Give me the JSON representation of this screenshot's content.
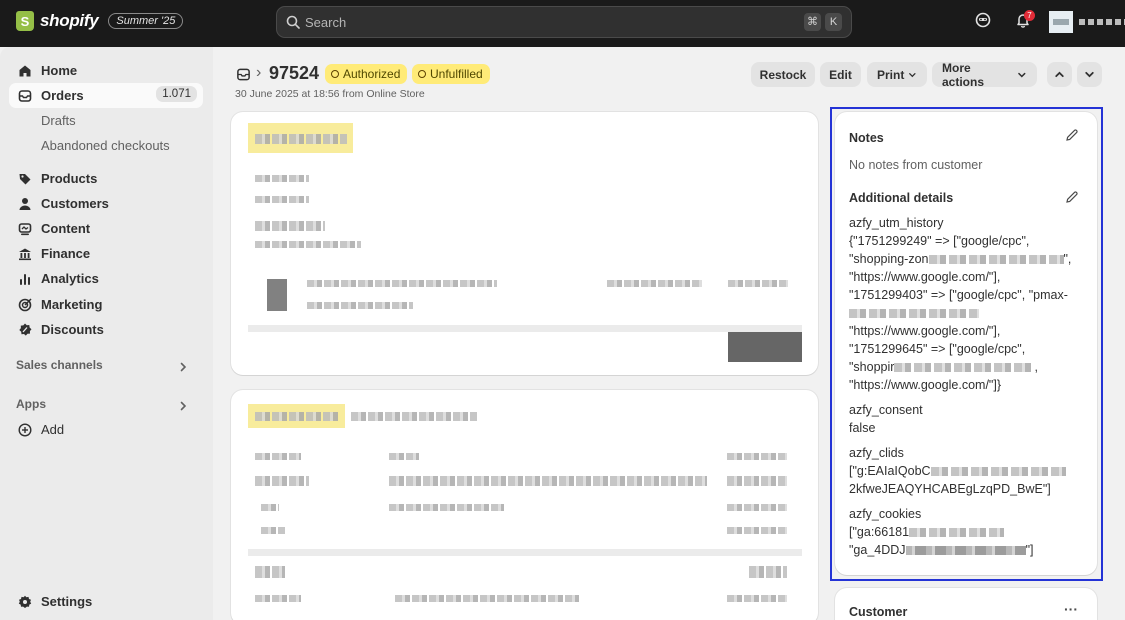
{
  "topbar": {
    "brand": "shopify",
    "brand_letter": "S",
    "edition": "Summer '25",
    "search_placeholder": "Search",
    "shortcut_keys": [
      "⌘",
      "K"
    ],
    "notification_count": "7",
    "icons": [
      "search-icon",
      "chat-icon",
      "bell-icon"
    ]
  },
  "sidebar": {
    "items": [
      {
        "label": "Home",
        "icon": "home-icon"
      },
      {
        "label": "Orders",
        "icon": "orders-icon",
        "count": "1.071"
      },
      {
        "label": "Drafts"
      },
      {
        "label": "Abandoned checkouts"
      },
      {
        "label": "Products",
        "icon": "tag-icon"
      },
      {
        "label": "Customers",
        "icon": "person-icon"
      },
      {
        "label": "Content",
        "icon": "content-icon"
      },
      {
        "label": "Finance",
        "icon": "bank-icon"
      },
      {
        "label": "Analytics",
        "icon": "chart-icon"
      },
      {
        "label": "Marketing",
        "icon": "target-icon"
      },
      {
        "label": "Discounts",
        "icon": "discount-icon"
      }
    ],
    "sales_channels": "Sales channels",
    "apps": "Apps",
    "add": "Add",
    "settings": "Settings"
  },
  "order": {
    "id": "97524",
    "separator": "›",
    "badges": [
      "Authorized",
      "Unfulfilled"
    ],
    "subtitle": "30 June 2025 at 18:56 from Online Store",
    "actions": {
      "restock": "Restock",
      "edit": "Edit",
      "print": "Print",
      "more": "More actions"
    }
  },
  "notes": {
    "title": "Notes",
    "empty": "No notes from customer",
    "additional_title": "Additional details",
    "fields": [
      {
        "key": "azfy_utm_history",
        "lines": [
          "{\"1751299249\" => [\"google/cpc\",",
          "\"shopping-zon",
          "\"https://www.google.com/\"],",
          "\"1751299403\" => [\"google/cpc\", \"pmax-",
          "",
          "\"https://www.google.com/\"],",
          "\"1751299645\" => [\"google/cpc\",",
          "\"shoppir",
          "\"https://www.google.com/\"]}"
        ]
      },
      {
        "key": "azfy_consent",
        "lines": [
          "false"
        ]
      },
      {
        "key": "azfy_clids",
        "lines": [
          "[\"g:EAIaIQobC",
          "2kfweJEAQYHCABEgLzqPD_BwE\"]"
        ]
      },
      {
        "key": "azfy_cookies",
        "lines": [
          "[\"ga:66181",
          "\"ga_4DDJ"
        ]
      }
    ]
  },
  "customer": {
    "title": "Customer",
    "menu": "···"
  }
}
